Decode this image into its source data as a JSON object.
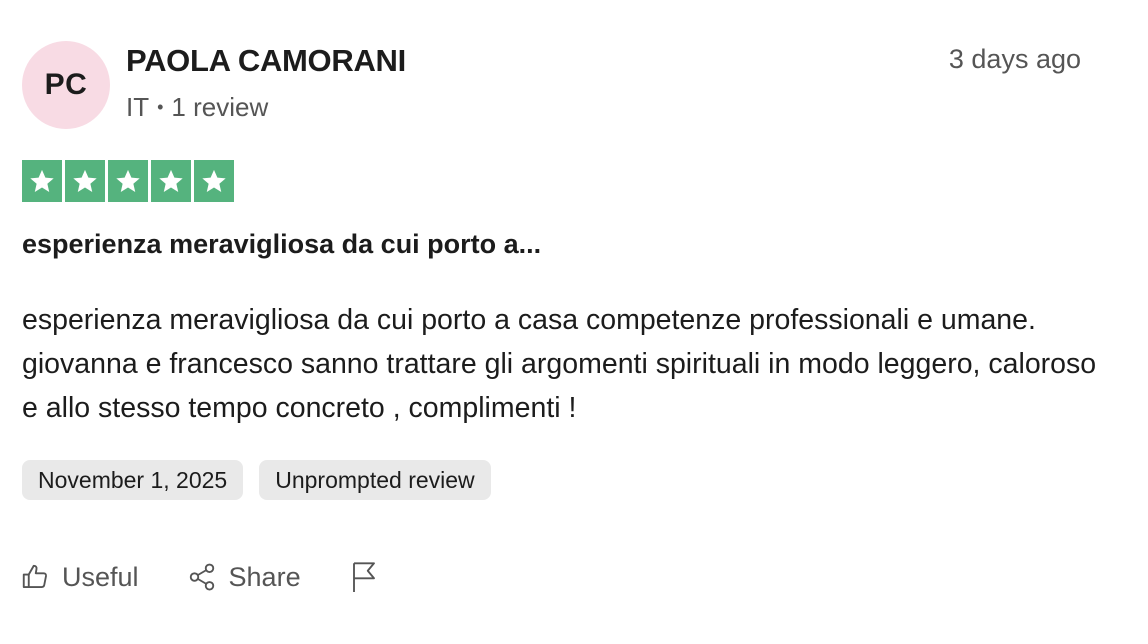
{
  "reviewer": {
    "initials": "PC",
    "name": "PAOLA CAMORANI",
    "country": "IT",
    "review_count": "1 review"
  },
  "timestamp": "3 days ago",
  "rating": {
    "stars": 5,
    "max": 5,
    "color": "#55b37e"
  },
  "review": {
    "title": "esperienza meravigliosa da cui porto a...",
    "body": "esperienza meravigliosa da cui porto a casa competenze professionali e umane. giovanna e francesco sanno trattare gli argomenti spirituali in modo leggero, caloroso e allo stesso tempo concreto , complimenti !"
  },
  "chips": {
    "date": "November 1, 2025",
    "type": "Unprompted review"
  },
  "actions": {
    "useful_label": "Useful",
    "share_label": "Share",
    "useful_icon": "thumbs-up-icon",
    "share_icon": "share-icon",
    "report_icon": "flag-icon"
  }
}
